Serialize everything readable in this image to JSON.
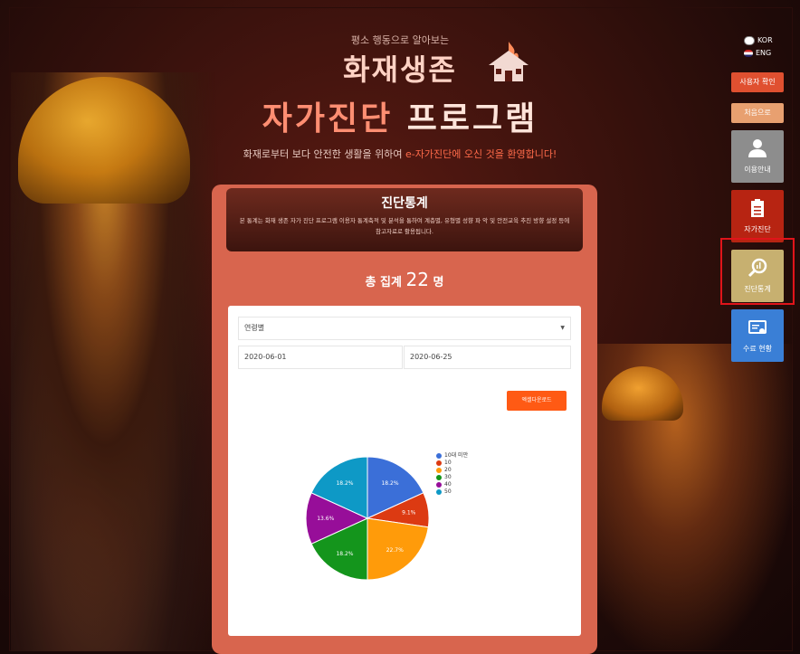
{
  "header": {
    "subtitle": "평소 행동으로 알아보는",
    "title_line1": "화재생존",
    "title_line2_a": "자가진단",
    "title_line2_b": "프로그램",
    "welcome_a": "화재로부터 보다 안전한 생활을 위하여 ",
    "welcome_b": "e-자가진단에 오신 것을 환영합니다!"
  },
  "lang": {
    "kor": "KOR",
    "eng": "ENG"
  },
  "nav": {
    "user_check": "사용자 확인",
    "home": "처음으로",
    "guide": "이용안내",
    "self_diagnosis": "자가진단",
    "stats": "진단통계",
    "completion": "수료 현황"
  },
  "panel": {
    "title": "진단통계",
    "description": "본 통계는 화재 생존 자가 진단 프로그램 이용자 통계축적 및 분석을 통하여 계층별, 유형별 성향 파 악 및 안전교육 추진 방향 설정 등에 참고자료로 활용됩니다.",
    "total_prefix": "총 집계",
    "total_count": "22",
    "total_unit": "명"
  },
  "filters": {
    "category": "연령별",
    "start_date": "2020-06-01",
    "end_date": "2020-06-25",
    "download_label": "엑셀다운로드"
  },
  "chart_data": {
    "type": "pie",
    "series": [
      {
        "name": "10대 미만",
        "value": 18.2,
        "label": "18.2%",
        "color": "#3b6fd8"
      },
      {
        "name": "10",
        "value": 9.1,
        "label": "9.1%",
        "color": "#dc3a12"
      },
      {
        "name": "20",
        "value": 22.7,
        "label": "22.7%",
        "color": "#ff9b0a"
      },
      {
        "name": "30",
        "value": 18.2,
        "label": "18.2%",
        "color": "#14951c"
      },
      {
        "name": "40",
        "value": 13.6,
        "label": "13.6%",
        "color": "#970e99"
      },
      {
        "name": "50",
        "value": 18.2,
        "label": "18.2%",
        "color": "#0e99c6"
      }
    ]
  }
}
